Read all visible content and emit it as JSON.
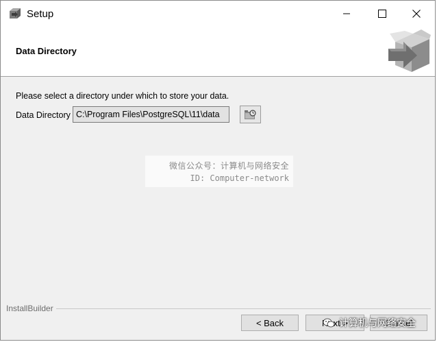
{
  "window": {
    "title": "Setup",
    "controls": {
      "minimize": "minimize-icon",
      "maximize": "maximize-icon",
      "close": "close-icon"
    }
  },
  "header": {
    "title": "Data Directory",
    "logo": "installer-box-arrow-icon"
  },
  "body": {
    "instruction": "Please select a directory under which to store your data.",
    "field_label": "Data Directory",
    "field_value": "C:\\Program Files\\PostgreSQL\\11\\data",
    "browse_icon": "folder-browse-icon"
  },
  "watermark": {
    "line1": "微信公众号：计算机与网络安全",
    "line2": "ID: Computer-network"
  },
  "footer": {
    "brand": "InstallBuilder",
    "back_label": "< Back",
    "next_label": "Next >",
    "cancel_label": "Cancel",
    "overlay_text": "计算机与网络安全"
  },
  "colors": {
    "window_bg": "#f0f0f0",
    "header_bg": "#ffffff",
    "input_bg": "#e2e2e2",
    "button_bg": "#e1e1e1"
  }
}
